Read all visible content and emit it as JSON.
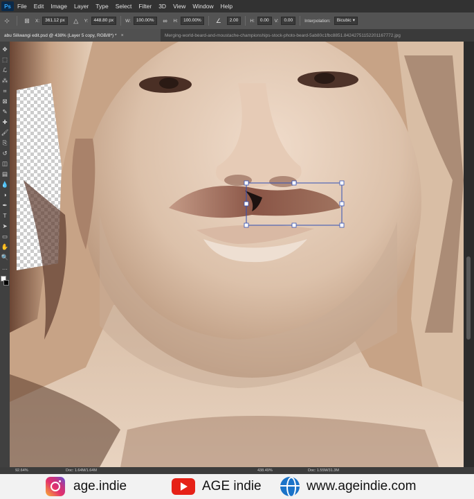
{
  "menu": {
    "app_logo": "Ps",
    "items": [
      "File",
      "Edit",
      "Image",
      "Layer",
      "Type",
      "Select",
      "Filter",
      "3D",
      "View",
      "Window",
      "Help"
    ]
  },
  "options_bar": {
    "x_label": "X:",
    "x_value": "361.12 px",
    "y_label": "Y:",
    "y_value": "448.80 px",
    "w_label": "W:",
    "w_value": "100.00%",
    "h_label": "H:",
    "h_value": "100.00%",
    "angle_value": "2.00",
    "h_skew_label": "H:",
    "h_skew_value": "0.00",
    "v_skew_label": "V:",
    "v_skew_value": "0.00",
    "interpolation_label": "Interpolation:",
    "interpolation_value": "Bicubic"
  },
  "tabs": [
    {
      "label": "abu Siliwangi edit.psd @ 438% (Layer 5 copy, RGB/8*) *",
      "close": "×"
    },
    {
      "label": "Merging-world-beard-and-moustache-championships-stock-photo-beard-5ab80c1fbc8851.84242751152201167772.jpg"
    }
  ],
  "toolbar": {
    "tools": [
      "move-tool",
      "marquee-tool",
      "lasso-tool",
      "quick-select-tool",
      "crop-tool",
      "frame-tool",
      "eyedropper-tool",
      "healing-tool",
      "brush-tool",
      "clone-tool",
      "history-brush-tool",
      "eraser-tool",
      "gradient-tool",
      "blur-tool",
      "dodge-tool",
      "pen-tool",
      "type-tool",
      "path-select-tool",
      "shape-tool",
      "hand-tool",
      "zoom-tool",
      "more-tools"
    ],
    "glyphs": [
      "✥",
      "⬚",
      "ℒ",
      "⁂",
      "⌗",
      "⊠",
      "✎",
      "✚",
      "🖌",
      "⎘",
      "↺",
      "◫",
      "▤",
      "💧",
      "◑",
      "✒",
      "T",
      "➤",
      "▭",
      "✋",
      "🔍",
      "…"
    ]
  },
  "status": {
    "zoom_left": "92.64%",
    "doc_left": "Doc: 1.64M/1.64M",
    "zoom_right": "438.49%",
    "doc_right": "Doc: 1.55M/31.3M"
  },
  "banner": {
    "instagram_handle": "age.indie",
    "youtube_channel": "AGE indie",
    "website": "www.ageindie.com"
  },
  "colors": {
    "menu_bg": "#323232",
    "options_bg": "#535353",
    "banner_bg": "#f2f2f2",
    "youtube_red": "#e62117",
    "globe_blue": "#1a73c8"
  }
}
